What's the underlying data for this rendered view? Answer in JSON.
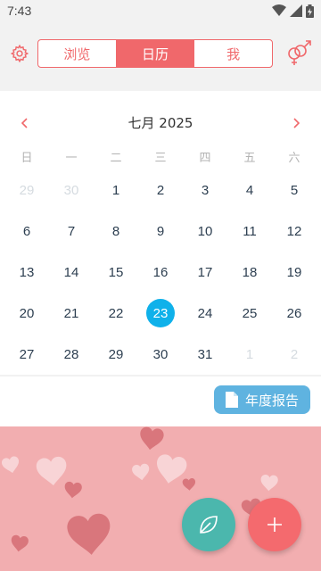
{
  "status": {
    "time": "7:43"
  },
  "tabs": [
    {
      "label": "浏览",
      "active": false
    },
    {
      "label": "日历",
      "active": true
    },
    {
      "label": "我",
      "active": false
    }
  ],
  "calendar": {
    "title": "七月 2025",
    "weekdays": [
      "日",
      "一",
      "二",
      "三",
      "四",
      "五",
      "六"
    ],
    "weeks": [
      [
        {
          "d": "29",
          "other": true
        },
        {
          "d": "30",
          "other": true
        },
        {
          "d": "1"
        },
        {
          "d": "2"
        },
        {
          "d": "3"
        },
        {
          "d": "4"
        },
        {
          "d": "5"
        }
      ],
      [
        {
          "d": "6"
        },
        {
          "d": "7"
        },
        {
          "d": "8"
        },
        {
          "d": "9"
        },
        {
          "d": "10"
        },
        {
          "d": "11"
        },
        {
          "d": "12"
        }
      ],
      [
        {
          "d": "13"
        },
        {
          "d": "14"
        },
        {
          "d": "15"
        },
        {
          "d": "16"
        },
        {
          "d": "17"
        },
        {
          "d": "18"
        },
        {
          "d": "19"
        }
      ],
      [
        {
          "d": "20"
        },
        {
          "d": "21"
        },
        {
          "d": "22"
        },
        {
          "d": "23",
          "selected": true
        },
        {
          "d": "24"
        },
        {
          "d": "25"
        },
        {
          "d": "26"
        }
      ],
      [
        {
          "d": "27"
        },
        {
          "d": "28"
        },
        {
          "d": "29"
        },
        {
          "d": "30"
        },
        {
          "d": "31"
        },
        {
          "d": "1",
          "other": true
        },
        {
          "d": "2",
          "other": true
        }
      ]
    ]
  },
  "report": {
    "label": "年度报告"
  },
  "colors": {
    "accent": "#f0686b",
    "selected": "#0fb1ea",
    "report": "#5fb3e0",
    "leaf_fab": "#4bb7ad",
    "add_fab": "#f46a6e",
    "hearts_bg": "#f2aeb0"
  },
  "icons": {
    "settings": "gear-icon",
    "gender": "gender-icon",
    "prev": "chevron-left-icon",
    "next": "chevron-right-icon",
    "report": "document-icon",
    "leaf": "leaf-icon",
    "add": "plus-icon"
  }
}
